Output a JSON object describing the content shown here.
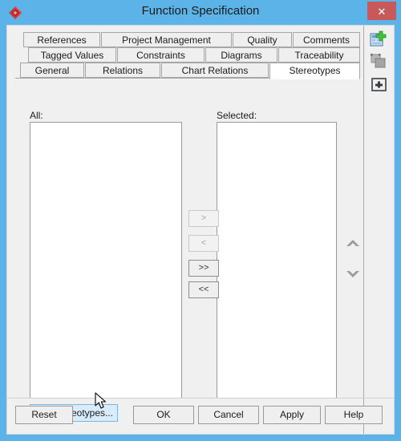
{
  "window": {
    "title": "Function Specification",
    "app_icon": "red-diamond-icon",
    "close_label": "✕",
    "accent_color": "#5cb3e8",
    "close_color": "#c65a5a"
  },
  "tabs": {
    "row1": [
      {
        "label": "References",
        "active": false
      },
      {
        "label": "Project Management",
        "active": false
      },
      {
        "label": "Quality",
        "active": false
      },
      {
        "label": "Comments",
        "active": false
      }
    ],
    "row2": [
      {
        "label": "Tagged Values",
        "active": false
      },
      {
        "label": "Constraints",
        "active": false
      },
      {
        "label": "Diagrams",
        "active": false
      },
      {
        "label": "Traceability",
        "active": false
      }
    ],
    "row3": [
      {
        "label": "General",
        "active": false
      },
      {
        "label": "Relations",
        "active": false
      },
      {
        "label": "Chart Relations",
        "active": false
      },
      {
        "label": "Stereotypes",
        "active": true
      }
    ]
  },
  "panel": {
    "all_label": "All:",
    "selected_label": "Selected:",
    "all_items": [],
    "selected_items": [],
    "transfer_buttons": [
      {
        "label": ">",
        "name": "move-right-button",
        "enabled": false
      },
      {
        "label": "<",
        "name": "move-left-button",
        "enabled": false
      },
      {
        "label": ">>",
        "name": "move-all-right-button",
        "enabled": true
      },
      {
        "label": "<<",
        "name": "move-all-left-button",
        "enabled": true
      }
    ],
    "reorder": [
      {
        "name": "move-up-button",
        "icon": "chevron-up-icon"
      },
      {
        "name": "move-down-button",
        "icon": "chevron-down-icon"
      }
    ],
    "edit_button": "Edit Stereotypes..."
  },
  "sidebar": {
    "buttons": [
      {
        "name": "new-element-button",
        "icon": "document-add-icon"
      },
      {
        "name": "duplicate-button",
        "icon": "copy-icon"
      },
      {
        "name": "add-button",
        "icon": "plus-box-icon"
      }
    ]
  },
  "footer": {
    "reset": "Reset",
    "ok": "OK",
    "cancel": "Cancel",
    "apply": "Apply",
    "help": "Help"
  }
}
